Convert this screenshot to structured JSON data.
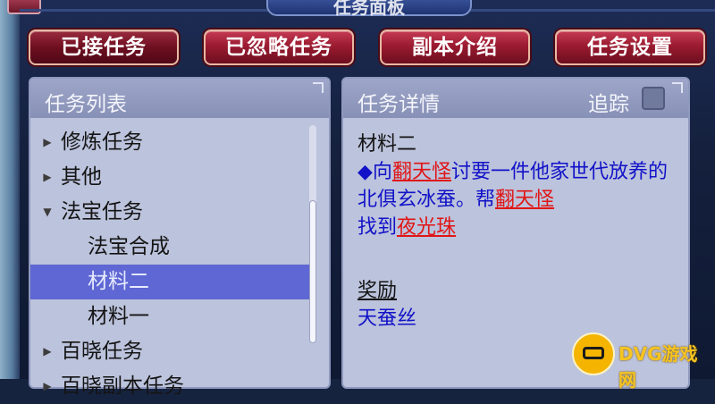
{
  "window": {
    "title": "任务面板"
  },
  "tabs": [
    {
      "label": "已接任务"
    },
    {
      "label": "已忽略任务"
    },
    {
      "label": "副本介绍"
    },
    {
      "label": "任务设置"
    }
  ],
  "task_list": {
    "header": "任务列表",
    "rows": [
      {
        "label": "修炼任务",
        "type": "category",
        "expanded": false
      },
      {
        "label": "其他",
        "type": "category",
        "expanded": false
      },
      {
        "label": "法宝任务",
        "type": "category",
        "expanded": true
      },
      {
        "label": "法宝合成",
        "type": "child"
      },
      {
        "label": "材料二",
        "type": "child",
        "selected": true
      },
      {
        "label": "材料一",
        "type": "child"
      },
      {
        "label": "百晓任务",
        "type": "category",
        "expanded": false
      },
      {
        "label": "百晓副本任务",
        "type": "category",
        "expanded": false
      }
    ]
  },
  "detail": {
    "header": "任务详情",
    "track_label": "追踪",
    "track_checked": false,
    "title": "材料二",
    "desc_bullet": "◆",
    "desc_1": "向",
    "npc_1": "翻天怪",
    "desc_2": "讨要一件他家世代放养的北俱玄冰蚕。帮",
    "npc_2": "翻天怪",
    "desc_3": "找到",
    "item": "夜光珠",
    "reward_heading": "奖励",
    "reward_value": "天蚕丝"
  },
  "watermark": {
    "text": "DVG游戏网"
  },
  "colors": {
    "tab_red": "#9b1b31",
    "panel_bg": "#bcc3dc",
    "selected_row": "#5e67d3",
    "desc_blue": "#1212c8",
    "npc_red": "#e01515"
  }
}
